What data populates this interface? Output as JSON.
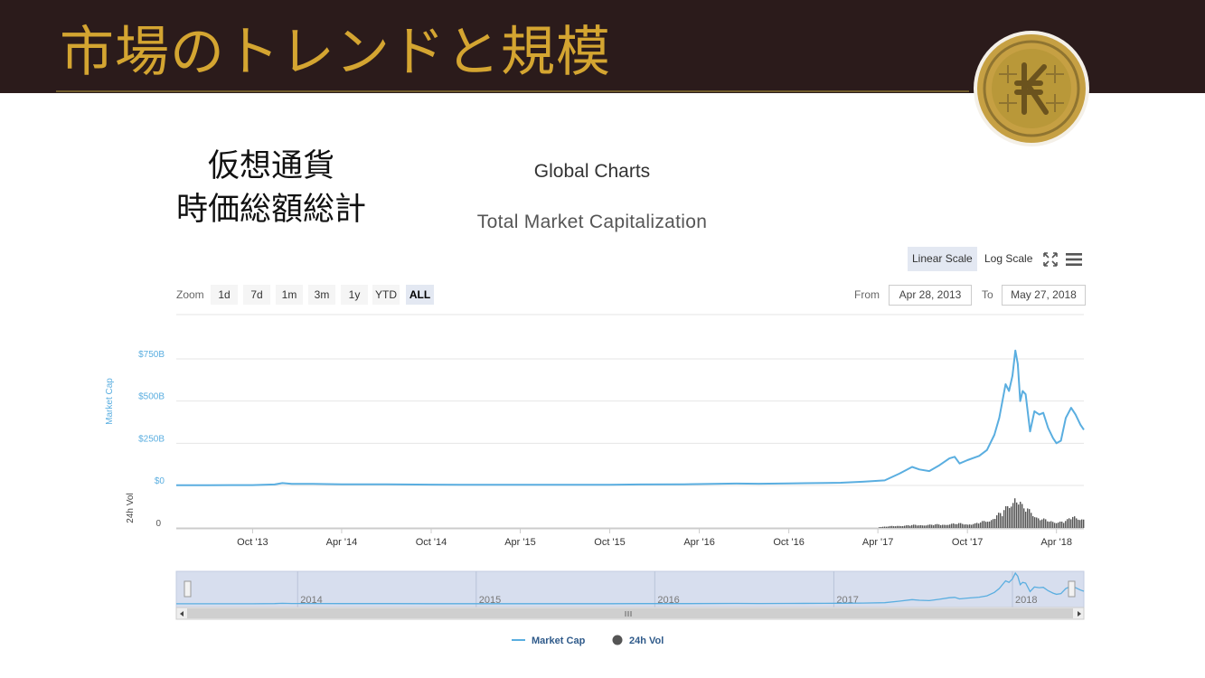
{
  "slide": {
    "title": "市場のトレンドと規模",
    "label_line1": "仮想通貨",
    "label_line2": "時価総額総計",
    "accent_color": "#d4a531",
    "header_color": "#2b1b1b",
    "logo_icon": "gold-coin-k-logo"
  },
  "page_title": "Global Charts",
  "toolbar": {
    "linear_label": "Linear Scale",
    "log_label": "Log Scale",
    "zoom_label": "Zoom",
    "zoom_options": [
      "1d",
      "7d",
      "1m",
      "3m",
      "1y",
      "YTD",
      "ALL"
    ],
    "active_zoom": "ALL",
    "from_label": "From",
    "from_value": "Apr 28, 2013",
    "to_label": "To",
    "to_value": "May 27, 2018"
  },
  "chart_data": {
    "type": "line",
    "title": "Total Market Capitalization",
    "x_range": [
      "2013-04-28",
      "2018-05-27"
    ],
    "x_ticks": [
      "Oct '13",
      "Apr '14",
      "Oct '14",
      "Apr '15",
      "Oct '15",
      "Apr '16",
      "Oct '16",
      "Apr '17",
      "Oct '17",
      "Apr '18"
    ],
    "y_axis": {
      "label": "Market Cap",
      "ticks": [
        "$0",
        "$250B",
        "$500B",
        "$750B"
      ],
      "range": [
        0,
        800
      ]
    },
    "vol_axis": {
      "label": "24h Vol",
      "ticks": [
        "0"
      ]
    },
    "navigator_ticks": [
      "2014",
      "2015",
      "2016",
      "2017",
      "2018"
    ],
    "legend": {
      "position": "bottom-center"
    },
    "grid": true,
    "colors": {
      "market_cap": "#5aaee0",
      "volume": "#555555"
    },
    "series": [
      {
        "name": "Market Cap",
        "unit": "billion USD",
        "points": [
          [
            "2013-04-28",
            1.5
          ],
          [
            "2013-07-01",
            1.5
          ],
          [
            "2013-10-01",
            2
          ],
          [
            "2013-11-15",
            6
          ],
          [
            "2013-12-01",
            14
          ],
          [
            "2013-12-20",
            9
          ],
          [
            "2014-02-01",
            9
          ],
          [
            "2014-04-01",
            7
          ],
          [
            "2014-07-01",
            7
          ],
          [
            "2014-10-01",
            5
          ],
          [
            "2015-01-01",
            4
          ],
          [
            "2015-04-01",
            4
          ],
          [
            "2015-07-01",
            4.5
          ],
          [
            "2015-10-01",
            4.2
          ],
          [
            "2015-12-01",
            6
          ],
          [
            "2016-03-01",
            7
          ],
          [
            "2016-06-15",
            11
          ],
          [
            "2016-08-01",
            10
          ],
          [
            "2016-10-01",
            12
          ],
          [
            "2016-12-15",
            15
          ],
          [
            "2017-01-15",
            16
          ],
          [
            "2017-03-01",
            22
          ],
          [
            "2017-04-15",
            30
          ],
          [
            "2017-05-15",
            70
          ],
          [
            "2017-06-10",
            110
          ],
          [
            "2017-06-25",
            95
          ],
          [
            "2017-07-15",
            85
          ],
          [
            "2017-08-05",
            120
          ],
          [
            "2017-08-25",
            160
          ],
          [
            "2017-09-05",
            170
          ],
          [
            "2017-09-15",
            130
          ],
          [
            "2017-10-01",
            150
          ],
          [
            "2017-10-25",
            175
          ],
          [
            "2017-11-10",
            210
          ],
          [
            "2017-11-25",
            300
          ],
          [
            "2017-12-05",
            400
          ],
          [
            "2017-12-18",
            600
          ],
          [
            "2017-12-25",
            560
          ],
          [
            "2018-01-01",
            650
          ],
          [
            "2018-01-07",
            800
          ],
          [
            "2018-01-12",
            720
          ],
          [
            "2018-01-17",
            500
          ],
          [
            "2018-01-22",
            560
          ],
          [
            "2018-01-28",
            540
          ],
          [
            "2018-02-06",
            320
          ],
          [
            "2018-02-15",
            440
          ],
          [
            "2018-02-25",
            420
          ],
          [
            "2018-03-05",
            430
          ],
          [
            "2018-03-15",
            340
          ],
          [
            "2018-03-25",
            280
          ],
          [
            "2018-04-01",
            250
          ],
          [
            "2018-04-10",
            265
          ],
          [
            "2018-04-20",
            400
          ],
          [
            "2018-05-01",
            460
          ],
          [
            "2018-05-10",
            420
          ],
          [
            "2018-05-20",
            360
          ],
          [
            "2018-05-27",
            330
          ]
        ]
      },
      {
        "name": "24h Vol",
        "unit": "relative",
        "points": [
          [
            "2017-04-01",
            3
          ],
          [
            "2017-06-01",
            8
          ],
          [
            "2017-08-01",
            10
          ],
          [
            "2017-09-15",
            13
          ],
          [
            "2017-10-15",
            12
          ],
          [
            "2017-11-15",
            25
          ],
          [
            "2017-12-10",
            45
          ],
          [
            "2017-12-22",
            70
          ],
          [
            "2018-01-05",
            95
          ],
          [
            "2018-01-20",
            60
          ],
          [
            "2018-02-05",
            55
          ],
          [
            "2018-02-20",
            30
          ],
          [
            "2018-03-10",
            22
          ],
          [
            "2018-04-01",
            18
          ],
          [
            "2018-04-20",
            20
          ],
          [
            "2018-05-05",
            38
          ],
          [
            "2018-05-27",
            22
          ]
        ]
      }
    ]
  }
}
